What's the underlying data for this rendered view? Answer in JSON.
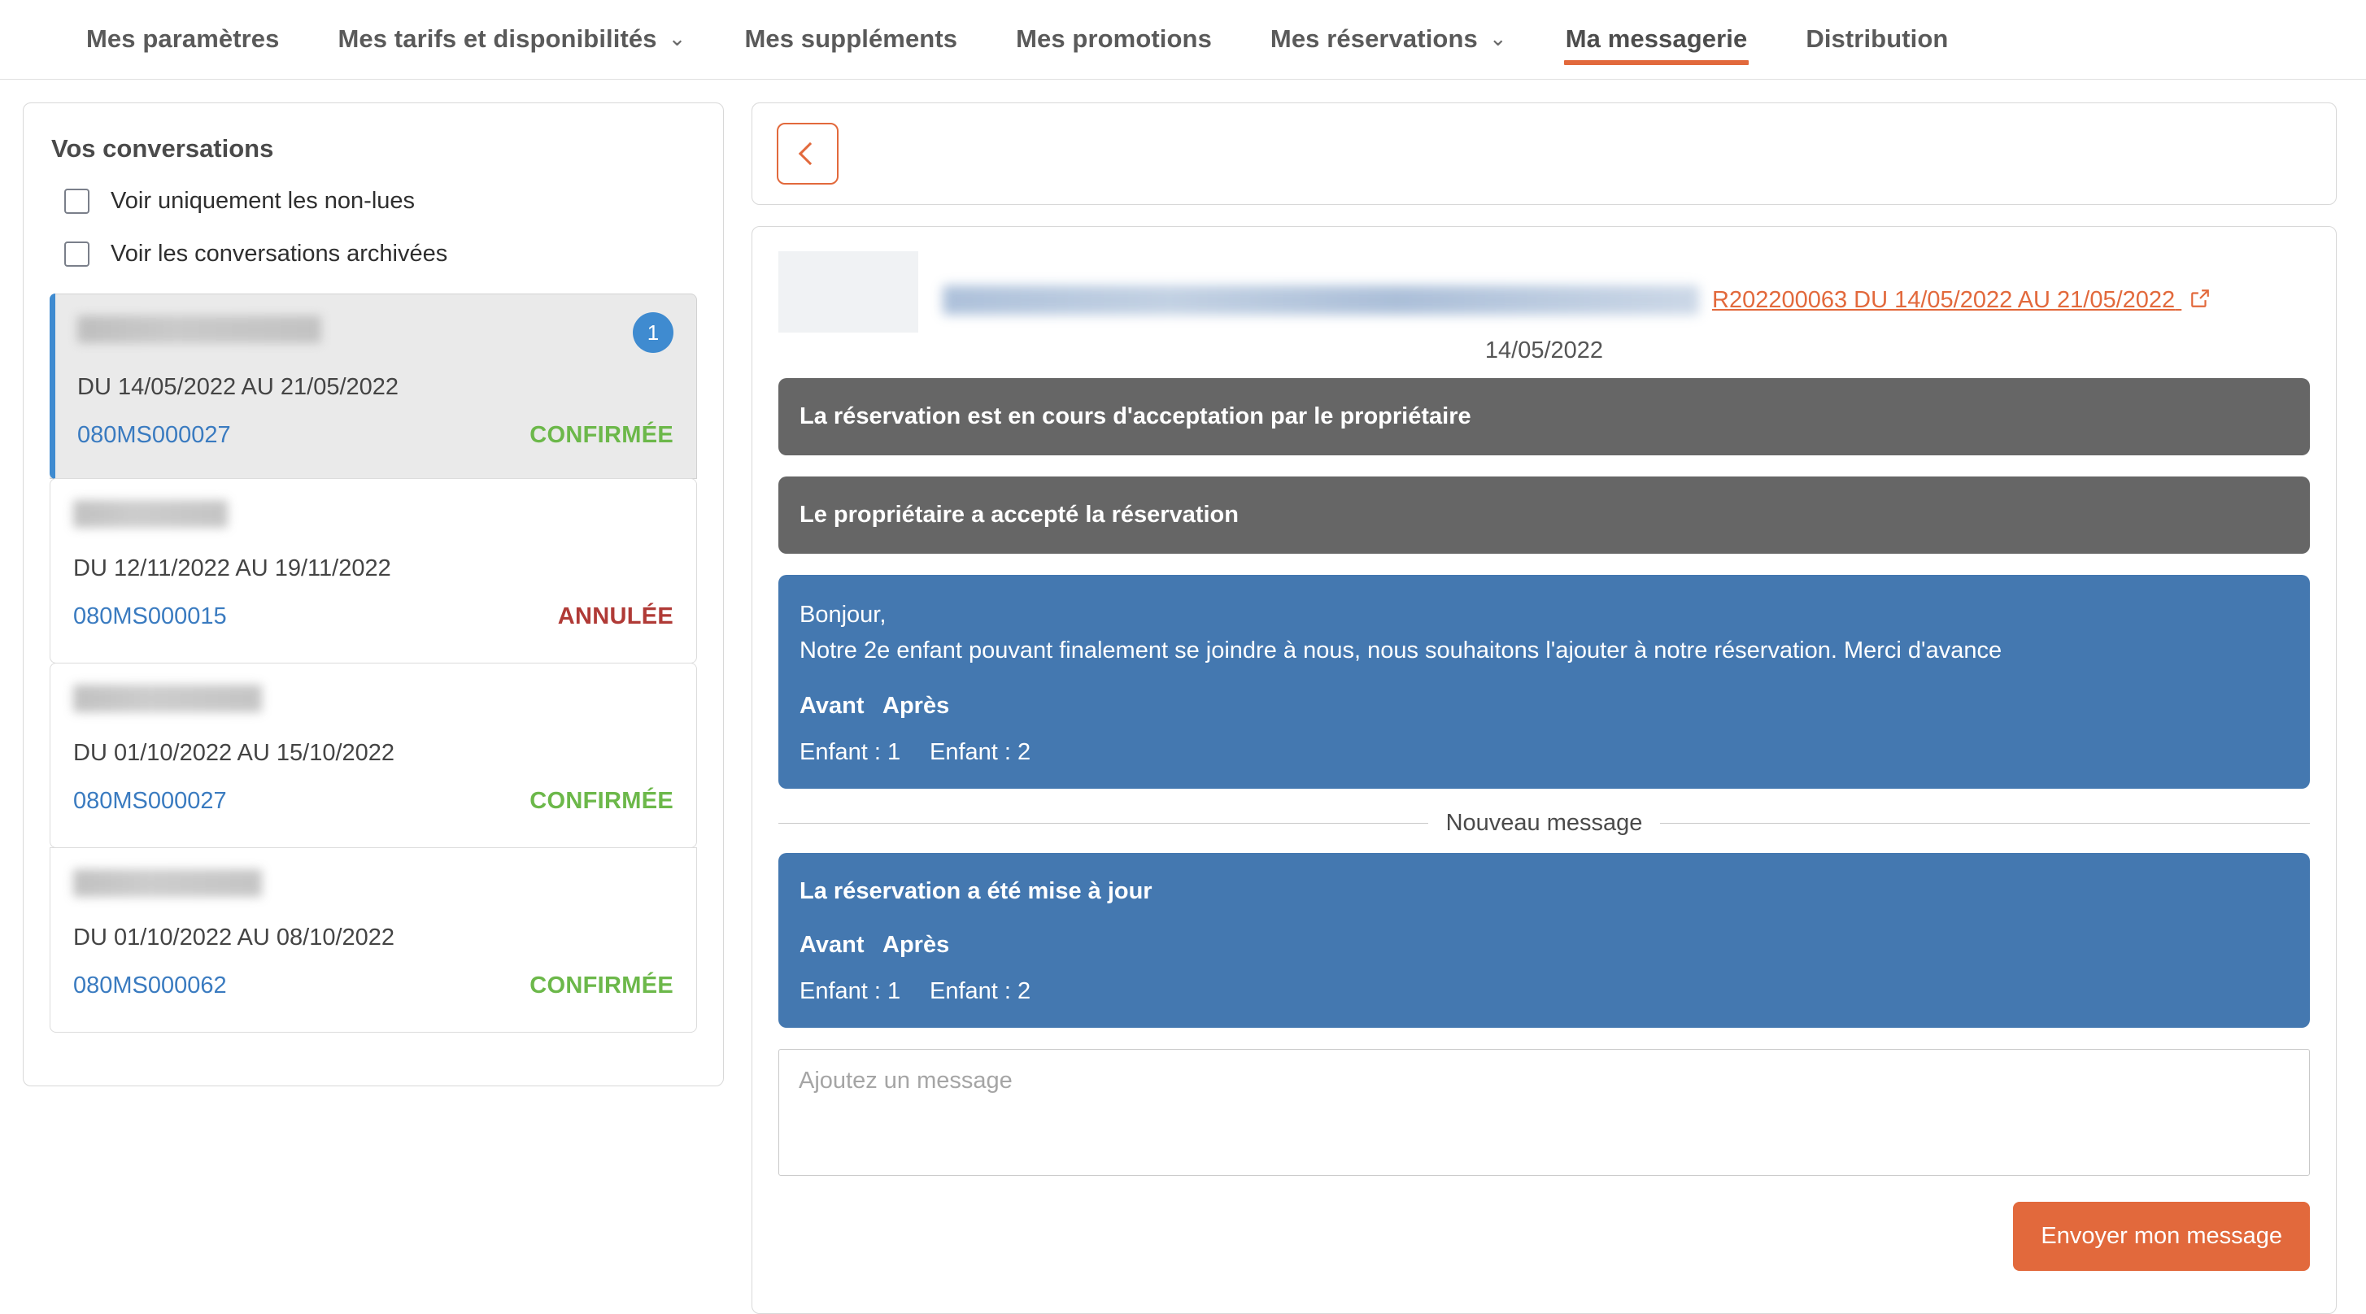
{
  "nav": {
    "tabs": [
      {
        "label": "Mes paramètres",
        "has_caret": false,
        "active": false
      },
      {
        "label": "Mes tarifs et disponibilités",
        "has_caret": true,
        "active": false
      },
      {
        "label": "Mes suppléments",
        "has_caret": false,
        "active": false
      },
      {
        "label": "Mes promotions",
        "has_caret": false,
        "active": false
      },
      {
        "label": "Mes réservations",
        "has_caret": true,
        "active": false
      },
      {
        "label": "Ma messagerie",
        "has_caret": false,
        "active": true
      },
      {
        "label": "Distribution",
        "has_caret": false,
        "active": false
      }
    ],
    "caret_glyph": "⌄"
  },
  "sidebar": {
    "title": "Vos conversations",
    "filters": [
      {
        "label": "Voir uniquement les non-lues",
        "checked": false
      },
      {
        "label": "Voir les conversations archivées",
        "checked": false
      }
    ],
    "conversations": [
      {
        "name_redacted": true,
        "name_width": 300,
        "dates": "DU 14/05/2022 AU 21/05/2022",
        "reference": "080MS000027",
        "status": "CONFIRMÉE",
        "status_kind": "confirmed",
        "unread_count": "1",
        "selected": true
      },
      {
        "name_redacted": true,
        "name_width": 190,
        "dates": "DU 12/11/2022 AU 19/11/2022",
        "reference": "080MS000015",
        "status": "ANNULÉE",
        "status_kind": "cancelled",
        "unread_count": "",
        "selected": false
      },
      {
        "name_redacted": true,
        "name_width": 232,
        "dates": "DU 01/10/2022 AU 15/10/2022",
        "reference": "080MS000027",
        "status": "CONFIRMÉE",
        "status_kind": "confirmed",
        "unread_count": "",
        "selected": false
      },
      {
        "name_redacted": true,
        "name_width": 232,
        "dates": "DU 01/10/2022 AU 08/10/2022",
        "reference": "080MS000062",
        "status": "CONFIRMÉE",
        "status_kind": "confirmed",
        "unread_count": "",
        "selected": false
      }
    ]
  },
  "thread": {
    "back_button_label": "",
    "property_title_redacted": true,
    "reservation_link": "R202200063 DU 14/05/2022 AU 21/05/2022",
    "date_separator": "14/05/2022",
    "messages": [
      {
        "kind": "system",
        "text": "La réservation est en cours d'acceptation par le propriétaire"
      },
      {
        "kind": "system",
        "text": "Le propriétaire a accepté la réservation"
      },
      {
        "kind": "message",
        "lines": [
          "Bonjour,",
          "Notre 2e enfant pouvant finalement se joindre à nous, nous souhaitons l'ajouter à notre réservation. Merci d'avance"
        ],
        "comparison": {
          "headers": [
            "Avant",
            "Après"
          ],
          "rows": [
            [
              "Enfant : 1",
              "Enfant : 2"
            ]
          ]
        }
      }
    ],
    "new_message_separator": "Nouveau message",
    "new_messages": [
      {
        "kind": "message",
        "title": "La réservation a été mise à jour",
        "comparison": {
          "headers": [
            "Avant",
            "Après"
          ],
          "rows": [
            [
              "Enfant : 1",
              "Enfant : 2"
            ]
          ]
        }
      }
    ]
  },
  "composer": {
    "placeholder": "Ajoutez un message",
    "value": "",
    "send_label": "Envoyer mon message"
  },
  "colors": {
    "accent_orange": "#e2693c",
    "bubble_blue": "#4478b0",
    "bubble_gray": "#666666",
    "status_confirmed": "#6cb84a",
    "status_cancelled": "#b03a36",
    "link_blue": "#3a7bc0",
    "badge_blue": "#3f8bd0"
  }
}
